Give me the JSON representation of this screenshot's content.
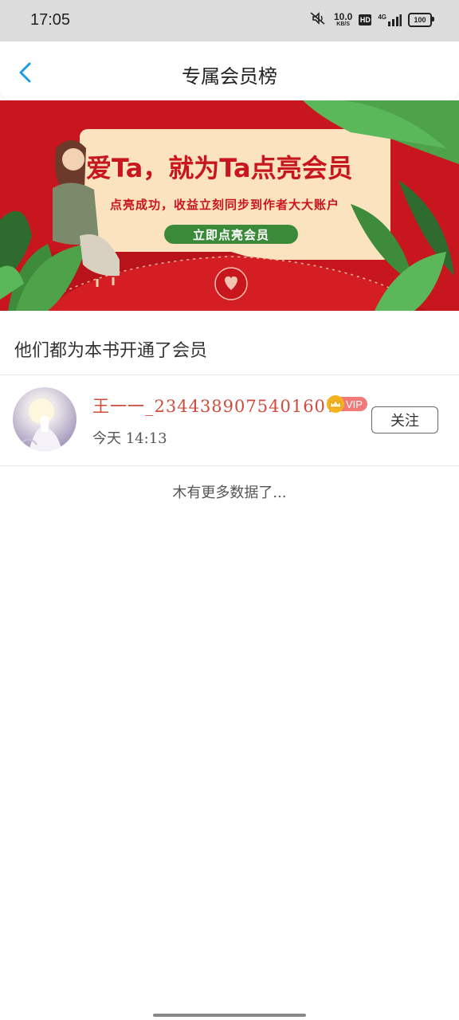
{
  "status_bar": {
    "time": "17:05",
    "net_speed_value": "10.0",
    "net_speed_unit": "KB/S",
    "hd_label": "HD",
    "network_label": "4G",
    "battery": "100"
  },
  "header": {
    "title": "专属会员榜"
  },
  "banner": {
    "headline": "爱Ta，就为Ta点亮会员",
    "subtitle": "点亮成功，收益立刻同步到作者大大账户",
    "cta_label": "立即点亮会员"
  },
  "section": {
    "title": "他们都为本书开通了会员"
  },
  "members": [
    {
      "name": "王一一_2344389075401607",
      "vip_label": "VIP",
      "time": "今天 14:13",
      "follow_label": "关注"
    }
  ],
  "footer": {
    "no_more_text": "木有更多数据了..."
  },
  "colors": {
    "banner_red": "#c8161e",
    "member_name": "#d24a3c",
    "back_arrow": "#1a9ee0",
    "cta_green": "#3a8a3a",
    "vip_pink": "#f07a7a",
    "vip_gold": "#f4b21c"
  },
  "icons": {
    "back": "chevron-left-icon",
    "mute": "mute-icon",
    "signal": "signal-bars-icon",
    "crown": "crown-icon"
  }
}
